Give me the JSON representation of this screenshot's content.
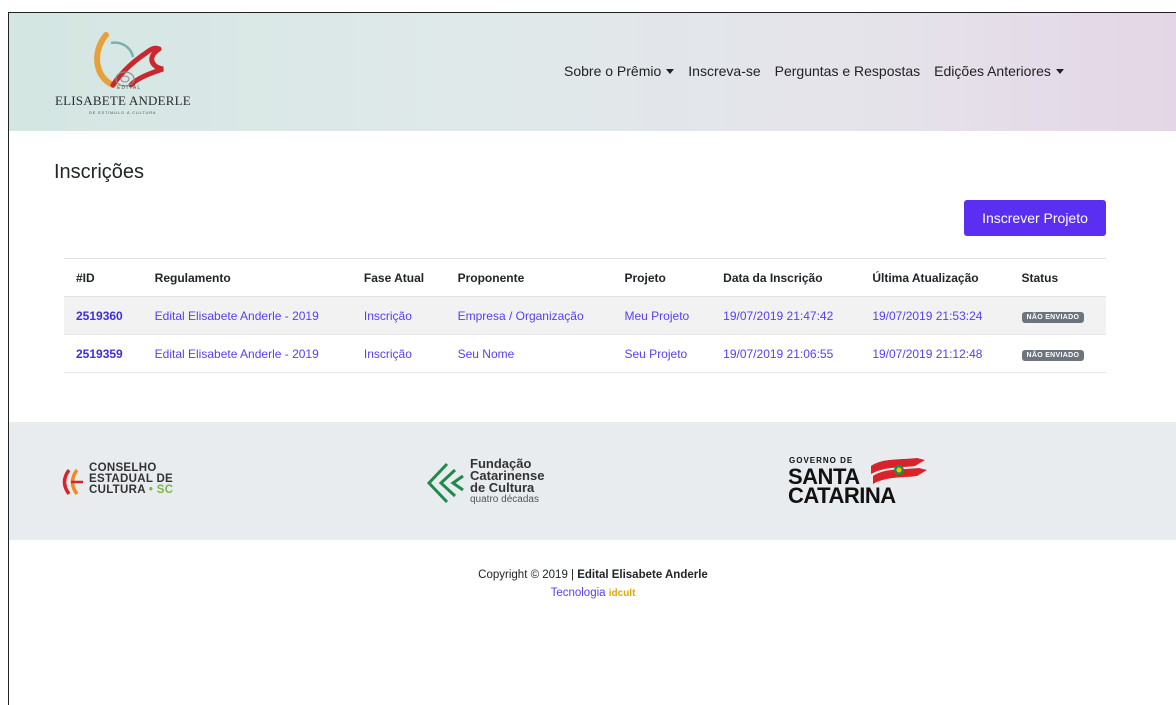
{
  "header": {
    "logo_text": "ELISABETE ANDERLE",
    "logo_small": "EDITAL",
    "logo_sub": "DE ESTÍMULO À CULTURA",
    "nav": [
      {
        "label": "Sobre o Prêmio",
        "dropdown": true
      },
      {
        "label": "Inscreva-se",
        "dropdown": false
      },
      {
        "label": "Perguntas e Respostas",
        "dropdown": false
      },
      {
        "label": "Edições Anteriores",
        "dropdown": true
      }
    ]
  },
  "main": {
    "title": "Inscrições",
    "new_button": "Inscrever Projeto",
    "columns": [
      "#ID",
      "Regulamento",
      "Fase Atual",
      "Proponente",
      "Projeto",
      "Data da Inscrição",
      "Última Atualização",
      "Status"
    ],
    "rows": [
      {
        "id": "2519360",
        "regulamento": "Edital Elisabete Anderle - 2019",
        "fase": "Inscrição",
        "proponente": "Empresa / Organização",
        "projeto": "Meu Projeto",
        "data": "19/07/2019 21:47:42",
        "atualizacao": "19/07/2019 21:53:24",
        "status": "NÃO ENVIADO"
      },
      {
        "id": "2519359",
        "regulamento": "Edital Elisabete Anderle - 2019",
        "fase": "Inscrição",
        "proponente": "Seu Nome",
        "projeto": "Seu Projeto",
        "data": "19/07/2019 21:06:55",
        "atualizacao": "19/07/2019 21:12:48",
        "status": "NÃO ENVIADO"
      }
    ]
  },
  "footer": {
    "cesc": [
      "CONSELHO",
      "ESTADUAL DE",
      "CULTURA",
      "SC"
    ],
    "fcc": [
      "Fundação",
      "Catarinense",
      "de Cultura",
      "quatro décadas"
    ],
    "gov": [
      "GOVERNO DE",
      "SANTA",
      "CATARINA"
    ],
    "copyright_prefix": "Copyright © 2019 | ",
    "copyright_bold": "Edital Elisabete Anderle",
    "tech_label": "Tecnologia",
    "tech_brand": "idcult"
  },
  "colors": {
    "primary": "#5b2ff2",
    "link": "#5b3ef0",
    "badge": "#6c757d",
    "footer_bg": "#e9ecef"
  }
}
